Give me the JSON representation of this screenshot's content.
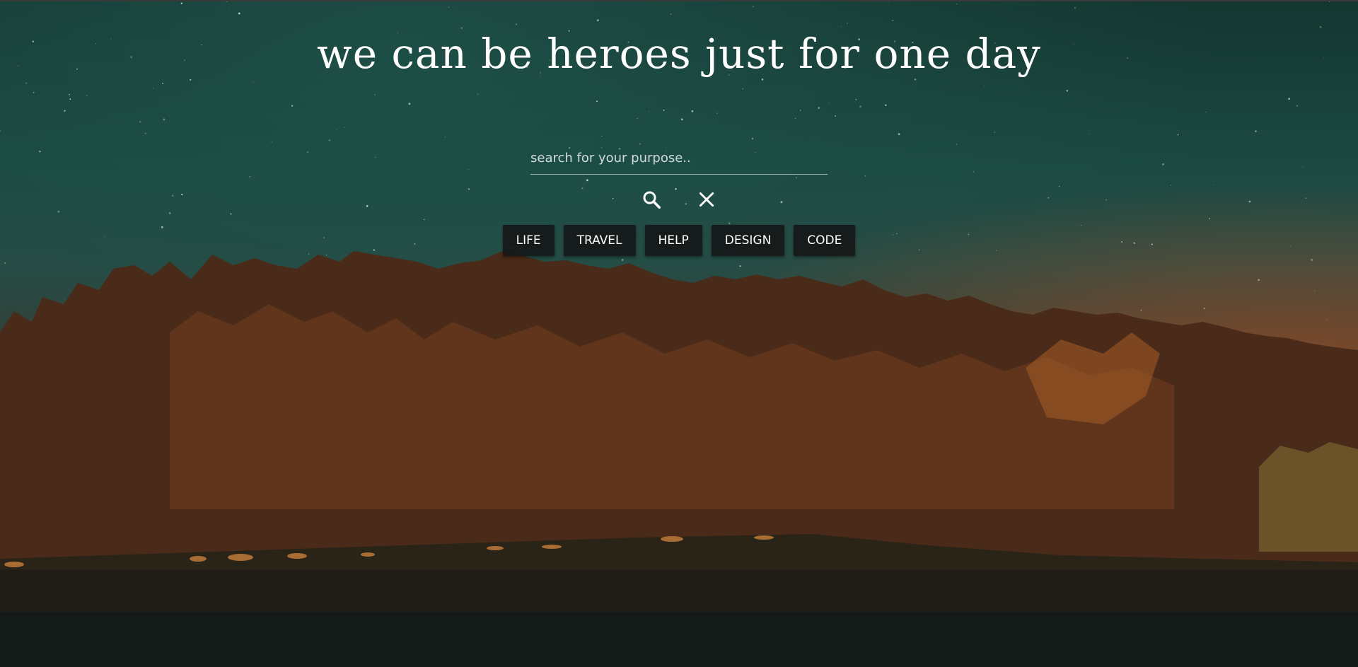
{
  "page": {
    "headline": "we can be heroes just for one day"
  },
  "search": {
    "placeholder": "search for your purpose..",
    "value": "",
    "search_icon": "search-icon",
    "clear_icon": "close-icon"
  },
  "categories": [
    {
      "label": "LIFE"
    },
    {
      "label": "TRAVEL"
    },
    {
      "label": "HELP"
    },
    {
      "label": "DESIGN"
    },
    {
      "label": "CODE"
    }
  ],
  "colors": {
    "text": "#ffffff",
    "button_bg": "#161818",
    "sky": "#1b4a42",
    "trees": "#6b3a1e"
  }
}
